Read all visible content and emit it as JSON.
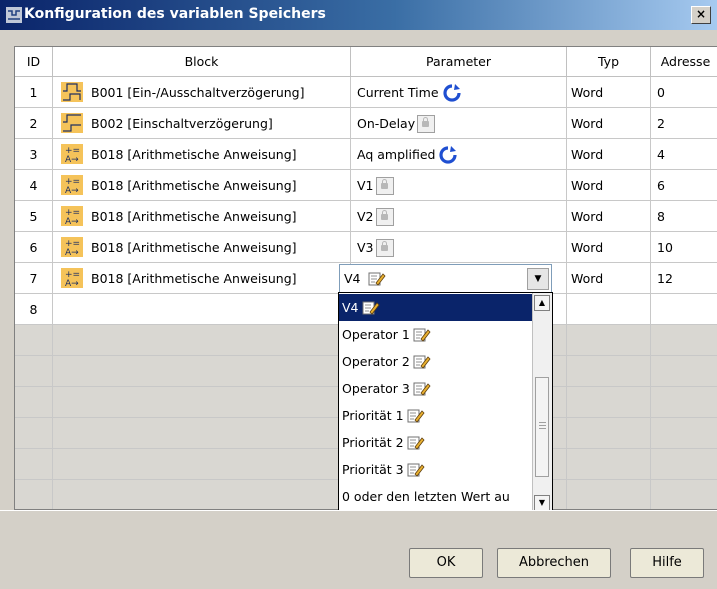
{
  "window": {
    "title": "Konfiguration des variablen Speichers",
    "close_label": "×"
  },
  "table": {
    "columns": [
      "ID",
      "Block",
      "Parameter",
      "Typ",
      "Adresse"
    ],
    "rows": [
      {
        "id": "1",
        "block": "B001 [Ein-/Ausschaltverzögerung]",
        "block_icon": "on-off-delay-icon",
        "param": "Current Time",
        "param_icon": "refresh-icon",
        "typ": "Word",
        "adr": "0"
      },
      {
        "id": "2",
        "block": "B002 [Einschaltverzögerung]",
        "block_icon": "on-delay-icon",
        "param": "On-Delay",
        "param_icon": "lock-icon",
        "typ": "Word",
        "adr": "2"
      },
      {
        "id": "3",
        "block": "B018 [Arithmetische Anweisung]",
        "block_icon": "arithmetic-icon",
        "param": "Aq amplified",
        "param_icon": "refresh-icon",
        "typ": "Word",
        "adr": "4"
      },
      {
        "id": "4",
        "block": "B018 [Arithmetische Anweisung]",
        "block_icon": "arithmetic-icon",
        "param": "V1",
        "param_icon": "lock-icon",
        "typ": "Word",
        "adr": "6"
      },
      {
        "id": "5",
        "block": "B018 [Arithmetische Anweisung]",
        "block_icon": "arithmetic-icon",
        "param": "V2",
        "param_icon": "lock-icon",
        "typ": "Word",
        "adr": "8"
      },
      {
        "id": "6",
        "block": "B018 [Arithmetische Anweisung]",
        "block_icon": "arithmetic-icon",
        "param": "V3",
        "param_icon": "lock-icon",
        "typ": "Word",
        "adr": "10"
      },
      {
        "id": "7",
        "block": "B018 [Arithmetische Anweisung]",
        "block_icon": "arithmetic-icon",
        "param": "V4",
        "param_icon": "edit-icon",
        "typ": "Word",
        "adr": "12"
      },
      {
        "id": "8",
        "block": "",
        "param": "",
        "typ": "",
        "adr": ""
      }
    ]
  },
  "combo": {
    "value": "V4",
    "icon": "edit-icon"
  },
  "dropdown": {
    "options": [
      {
        "label": "V4",
        "icon": "edit-icon",
        "selected": true
      },
      {
        "label": "Operator 1",
        "icon": "edit-icon"
      },
      {
        "label": "Operator 2",
        "icon": "edit-icon"
      },
      {
        "label": "Operator 3",
        "icon": "edit-icon"
      },
      {
        "label": "Priorität 1",
        "icon": "edit-icon"
      },
      {
        "label": "Priorität 2",
        "icon": "edit-icon"
      },
      {
        "label": "Priorität 3",
        "icon": "edit-icon"
      },
      {
        "label": "0 oder den letzten Wert au"
      }
    ]
  },
  "buttons": {
    "ok": "OK",
    "cancel": "Abbrechen",
    "help": "Hilfe"
  },
  "colors": {
    "title_gradient_start": "#0a246a",
    "selection": "#0a246a",
    "block_icon_bg": "#f5c35a",
    "refresh_icon": "#1f4fd1"
  }
}
